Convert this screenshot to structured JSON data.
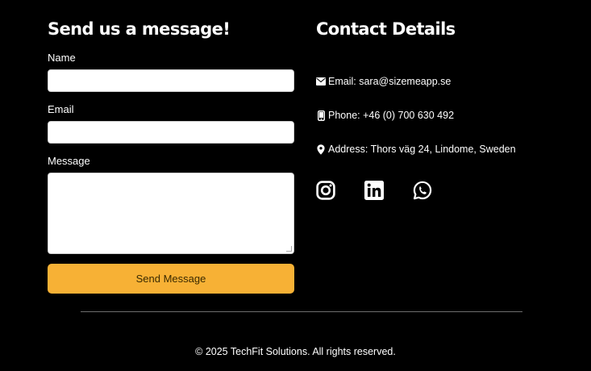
{
  "form": {
    "heading": "Send us a message!",
    "name_label": "Name",
    "name_value": "",
    "email_label": "Email",
    "email_value": "",
    "message_label": "Message",
    "message_value": "",
    "submit_label": "Send Message"
  },
  "contact": {
    "heading": "Contact Details",
    "email": "Email: sara@sizemeapp.se",
    "phone": "Phone: +46 (0) 700 630 492",
    "address": "Address: Thors väg 24, Lindome, Sweden",
    "icons": {
      "email": "envelope-icon",
      "phone": "mobile-phone-icon",
      "address": "map-pin-icon"
    },
    "socials": [
      "instagram-icon",
      "linkedin-icon",
      "whatsapp-icon"
    ]
  },
  "footer": {
    "copyright": "© 2025 TechFit Solutions. All rights reserved."
  },
  "colors": {
    "background": "#000000",
    "text": "#ffffff",
    "accent": "#f7b135",
    "divider": "#6e6e6e"
  }
}
